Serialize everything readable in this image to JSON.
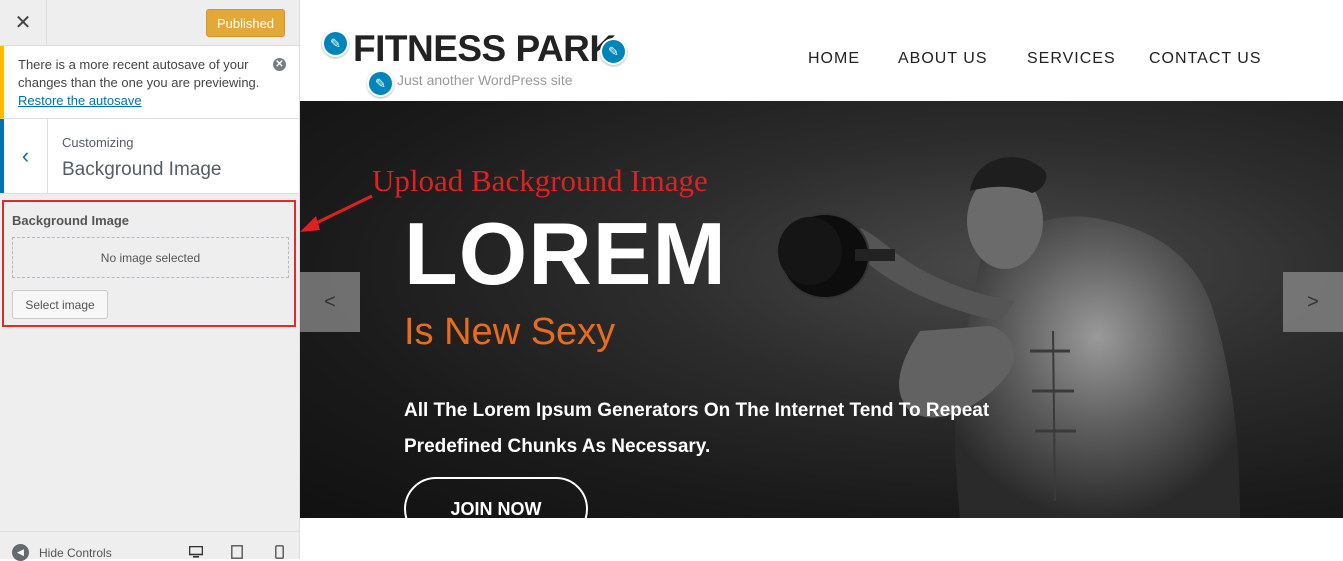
{
  "topbar": {
    "close_icon": "close-icon",
    "publish_label": "Published"
  },
  "notice": {
    "message": "There is a more recent autosave of your changes than the one you are previewing.",
    "link_label": "Restore the autosave"
  },
  "section": {
    "subtitle": "Customizing",
    "title": "Background Image"
  },
  "control": {
    "label": "Background Image",
    "placeholder": "No image selected",
    "select_label": "Select image"
  },
  "footer": {
    "hide_label": "Hide Controls"
  },
  "site": {
    "title": "FITNESS PARK",
    "tagline": "Just another WordPress site",
    "nav": [
      "HOME",
      "ABOUT US",
      "SERVICES",
      "CONTACT US"
    ]
  },
  "hero": {
    "title": "LOREM",
    "subtitle": "Is New Sexy",
    "text_line1": "All The Lorem Ipsum Generators On The Internet Tend To Repeat",
    "text_line2": "Predefined Chunks As Necessary.",
    "button_label": "JOIN NOW",
    "prev_label": "<",
    "next_label": ">"
  },
  "annotation": {
    "text": "Upload Background Image"
  },
  "colors": {
    "accent_blue": "#0073aa",
    "publish_orange": "#e2a838",
    "hero_orange": "#e86c1b",
    "annotation_red": "#e02020"
  }
}
